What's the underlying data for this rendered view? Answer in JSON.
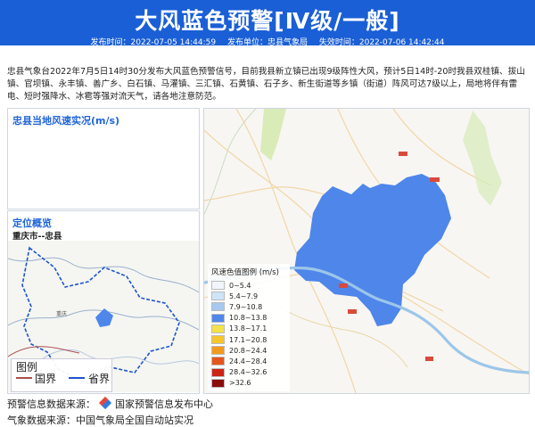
{
  "header": {
    "title": "大风蓝色预警[Ⅳ级/一般]",
    "publish_time": "发布时间：2022-07-05 14:44:59",
    "publisher": "发布单位：忠县气象局",
    "expiry": "失效时间：2022-07-06 14:42:44"
  },
  "content": "忠县气象台2022年7月5日14时30分发布大风蓝色预警信号，目前我县新立镇已出现9级阵性大风，预计5日14时-20时我县双桂镇、拔山镇、官坝镇、永丰镇、善广乡、白石镇、马灌镇、三汇镇、石黄镇、石子乡、新生街道等乡镇（街道）阵风可达7级以上，局地将伴有雷电、短时强降水、冰雹等强对流天气，请各地注意防范。",
  "wind_panel": {
    "title": "忠县当地风速实况(m/s)"
  },
  "locate_panel": {
    "title": "定位概览",
    "location": "重庆市--忠县"
  },
  "left_map_legend": {
    "title": "图例",
    "country": "国界",
    "province": "省界"
  },
  "wind_legend": {
    "title": "风速色值图例 (m/s)",
    "items": [
      {
        "label": "0~5.4",
        "color": "#f2f5fb"
      },
      {
        "label": "5.4~7.9",
        "color": "#cfe4f7"
      },
      {
        "label": "7.9~10.8",
        "color": "#a7c8ef"
      },
      {
        "label": "10.8~13.8",
        "color": "#4e86ea"
      },
      {
        "label": "13.8~17.1",
        "color": "#f3e24c"
      },
      {
        "label": "17.1~20.8",
        "color": "#f6c62d"
      },
      {
        "label": "20.8~24.4",
        "color": "#f29a1b"
      },
      {
        "label": "24.4~28.4",
        "color": "#e4561c"
      },
      {
        "label": "28.4~32.6",
        "color": "#cc2416"
      },
      {
        "label": ">32.6",
        "color": "#8c0c0c"
      }
    ]
  },
  "footer": {
    "source_label": "预警信息数据来源：",
    "source_value": "国家预警信息发布中心",
    "line2": "气象数据来源：中国气象局全国自动站实况"
  },
  "colors": {
    "header_bg": "#1a5fd6",
    "warning_area": "#4e86ea"
  }
}
